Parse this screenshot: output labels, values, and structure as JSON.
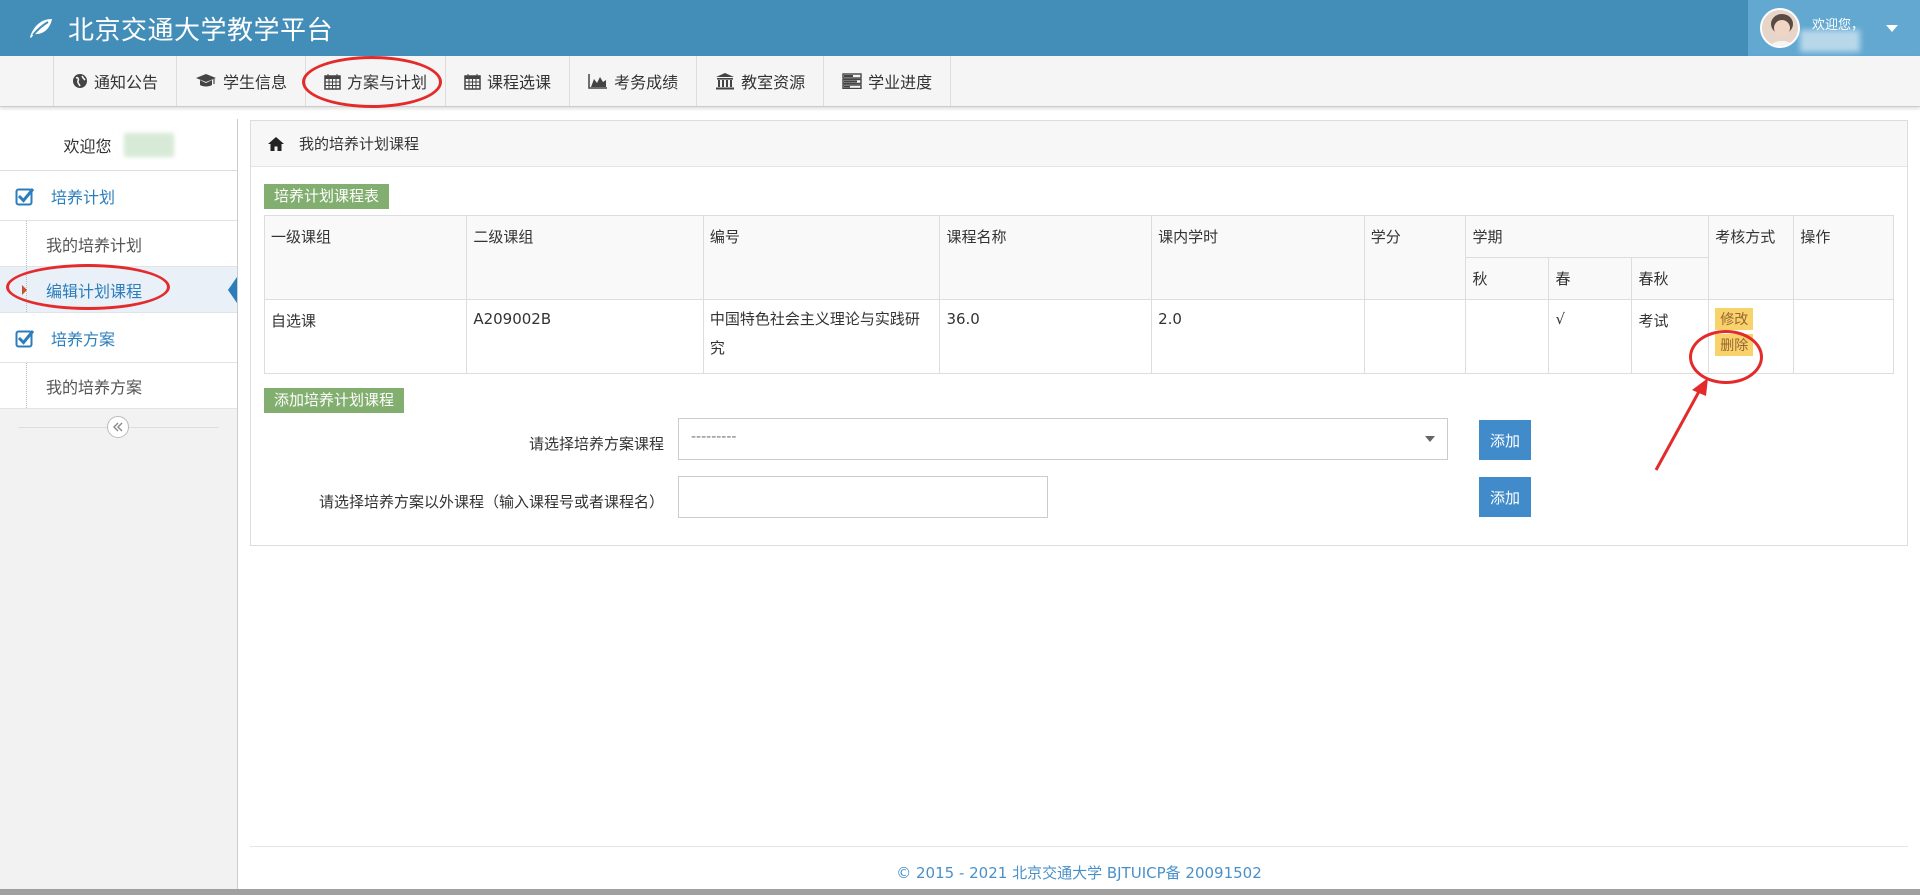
{
  "header": {
    "brand_title": "北京交通大学教学平台",
    "user_welcome": "欢迎您，",
    "icons": [
      "leaf-icon",
      "user-avatar",
      "caret-down-icon"
    ]
  },
  "nav": {
    "items": [
      {
        "label": "通知公告",
        "icon": "globe-icon"
      },
      {
        "label": "学生信息",
        "icon": "graduation-cap-icon"
      },
      {
        "label": "方案与计划",
        "icon": "calendar-icon"
      },
      {
        "label": "课程选课",
        "icon": "calendar-icon"
      },
      {
        "label": "考务成绩",
        "icon": "area-chart-icon"
      },
      {
        "label": "教室资源",
        "icon": "building-icon"
      },
      {
        "label": "学业进度",
        "icon": "tasks-icon"
      }
    ]
  },
  "sidebar": {
    "welcome": "欢迎您",
    "groups": [
      {
        "label": "培养计划",
        "items": [
          "我的培养计划",
          "编辑计划课程"
        ]
      },
      {
        "label": "培养方案",
        "items": [
          "我的培养方案"
        ]
      }
    ],
    "active_item": "编辑计划课程"
  },
  "breadcrumb": {
    "title": "我的培养计划课程"
  },
  "plan_table": {
    "label": "培养计划课程表",
    "headers": {
      "group1": "一级课组",
      "group2": "二级课组",
      "code": "编号",
      "name": "课程名称",
      "hours": "课内学时",
      "credit": "学分",
      "term": "学期",
      "term_autumn": "秋",
      "term_spring": "春",
      "term_both": "春秋",
      "exam": "考核方式",
      "action": "操作"
    },
    "rows": [
      {
        "group1": "自选课",
        "group2": "A209002B",
        "code": "中国特色社会主义理论与实践研究",
        "name": "36.0",
        "hours": "2.0",
        "credit": "",
        "autumn": "",
        "spring": "√",
        "both": "考试",
        "edit_label": "修改",
        "delete_label": "删除"
      }
    ]
  },
  "add_section": {
    "label": "添加培养计划课程",
    "select_label": "请选择培养方案课程",
    "select_value": "---------",
    "text_label": "请选择培养方案以外课程（输入课程号或者课程名）",
    "add_button": "添加"
  },
  "footer": {
    "text": "© 2015 - 2021 北京交通大学 BJTUICP备 20091502"
  },
  "colors": {
    "header_bg": "#438eb9",
    "accent_blue": "#2b7dbc",
    "label_green": "#82af6f",
    "button_blue": "#428bca",
    "warning_tag": "#f8d26b",
    "annotation_red": "#e32b2b"
  }
}
